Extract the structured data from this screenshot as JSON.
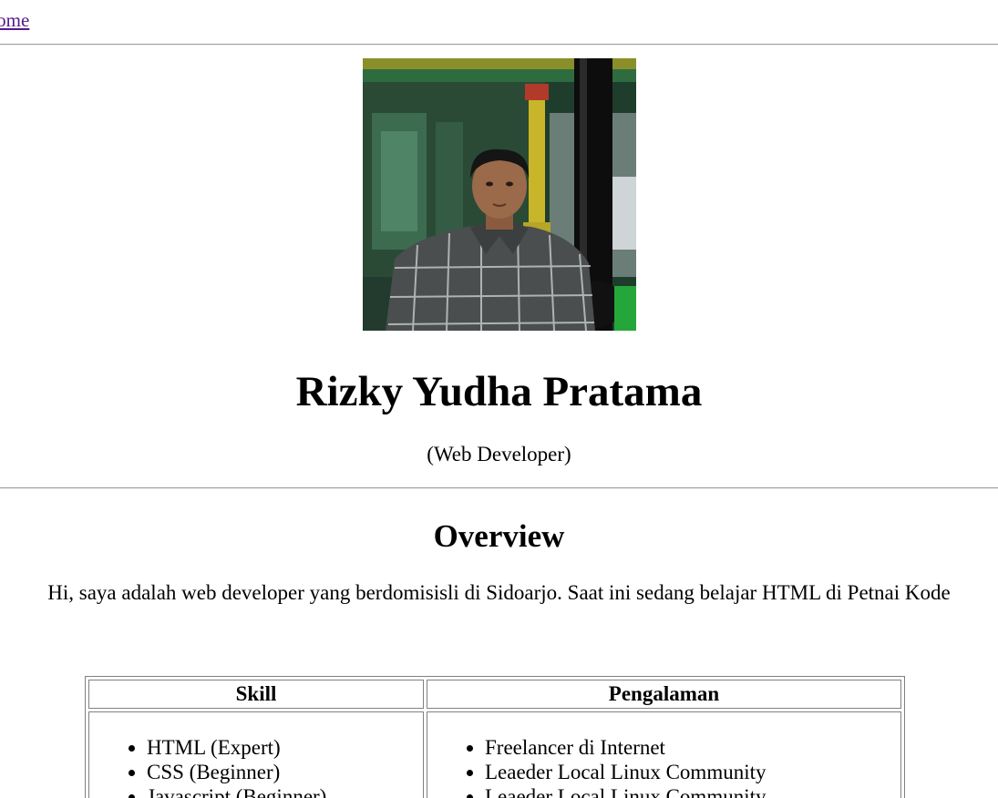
{
  "nav": {
    "home_label": "Home"
  },
  "profile": {
    "photo_alt": "Rizky Yudha Pratama",
    "name": "Rizky Yudha Pratama",
    "role": "(Web Developer)"
  },
  "overview": {
    "heading": "Overview",
    "text": "Hi, saya adalah web developer yang berdomisisli di Sidoarjo. Saat ini sedang belajar HTML di Petnai Kode"
  },
  "table": {
    "headers": [
      "Skill",
      "Pengalaman"
    ],
    "skills": [
      "HTML (Expert)",
      "CSS (Beginner)",
      "Javascript (Beginner)"
    ],
    "experience": [
      "Freelancer di Internet",
      "Leaeder Local Linux Community",
      "Leaeder Local Linux Community"
    ]
  },
  "colors": {
    "link_visited": "#551a8b",
    "rule": "#9e9e9e",
    "table_border": "#808080"
  }
}
